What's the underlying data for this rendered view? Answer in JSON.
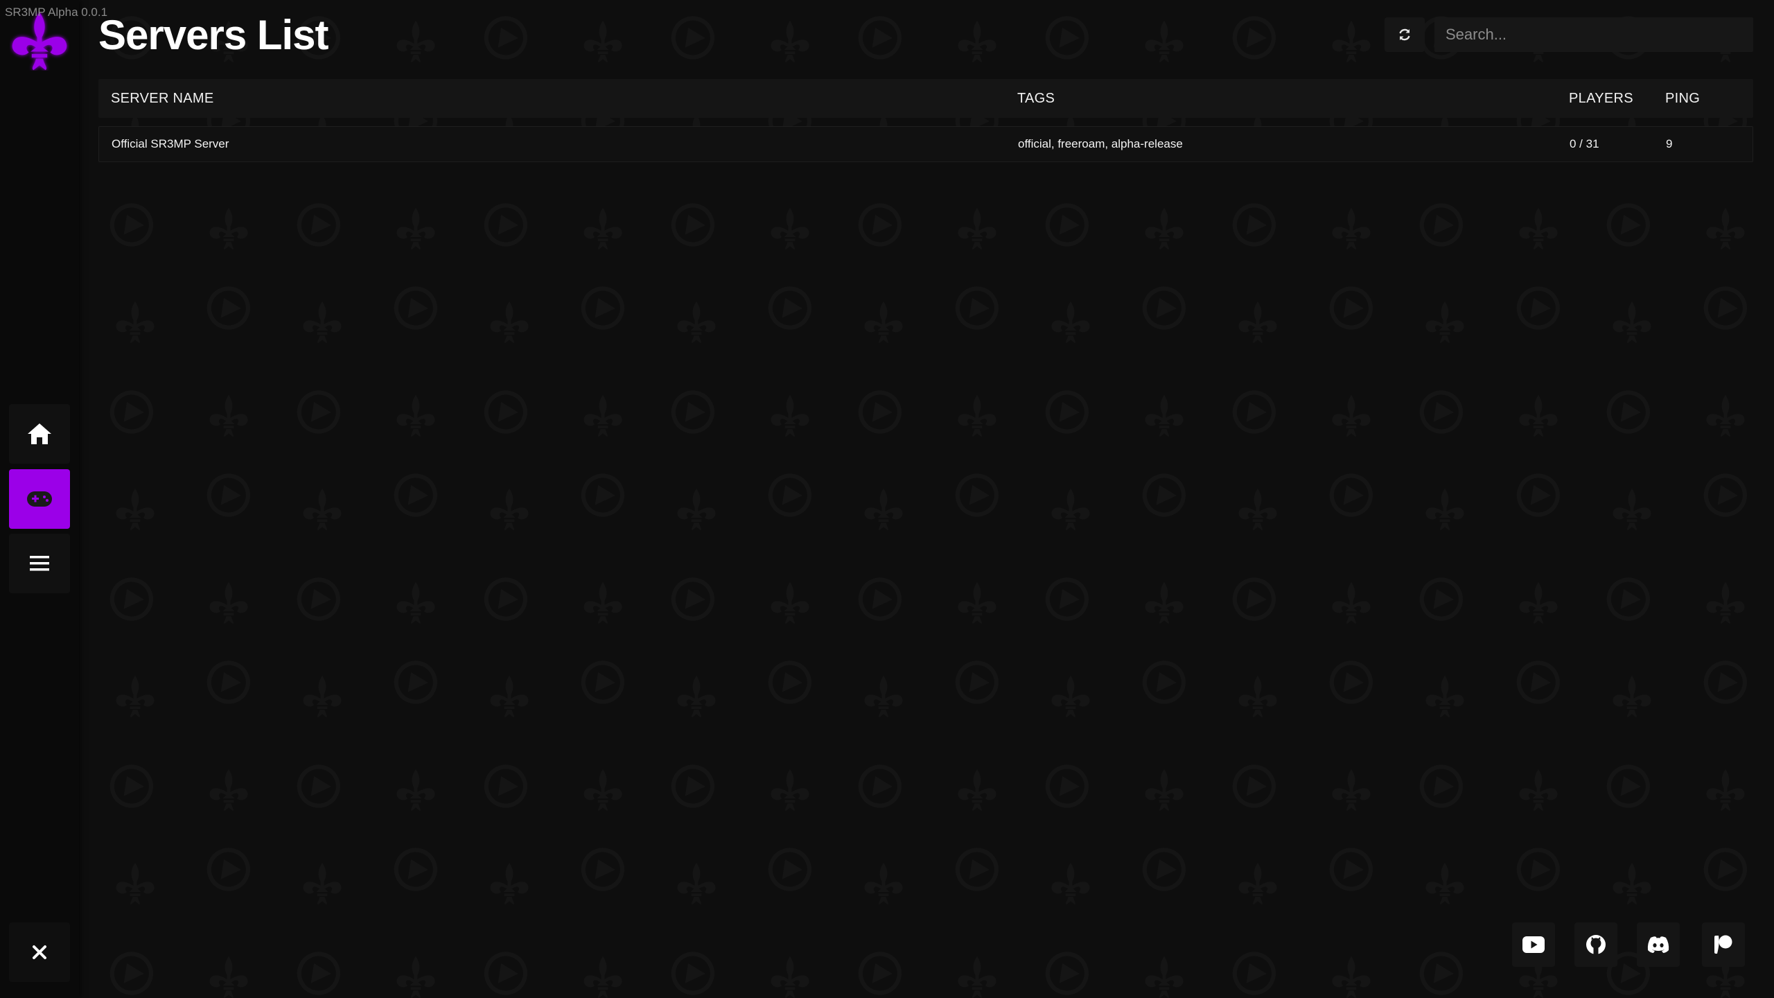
{
  "app": {
    "version": "SR3MP Alpha 0.0.1",
    "accent_color": "#9b00e8"
  },
  "sidebar": {
    "logo_icon": "fleur-de-lis-icon",
    "items": [
      {
        "name": "home",
        "icon": "home-icon",
        "active": false
      },
      {
        "name": "servers",
        "icon": "gamepad-icon",
        "active": true
      },
      {
        "name": "menu",
        "icon": "hamburger-menu-icon",
        "active": false
      }
    ],
    "close_icon": "close-icon"
  },
  "header": {
    "title": "Servers List",
    "refresh_icon": "refresh-icon",
    "search_placeholder": "Search..."
  },
  "table": {
    "columns": [
      "SERVER NAME",
      "TAGS",
      "PLAYERS",
      "PING"
    ],
    "rows": [
      {
        "name": "Official SR3MP Server",
        "tags": "official, freeroam, alpha-release",
        "players": "0 / 31",
        "ping": "9"
      }
    ]
  },
  "social": [
    {
      "name": "youtube",
      "icon": "youtube-icon"
    },
    {
      "name": "github",
      "icon": "github-icon"
    },
    {
      "name": "discord",
      "icon": "discord-icon"
    },
    {
      "name": "patreon",
      "icon": "patreon-icon"
    }
  ]
}
